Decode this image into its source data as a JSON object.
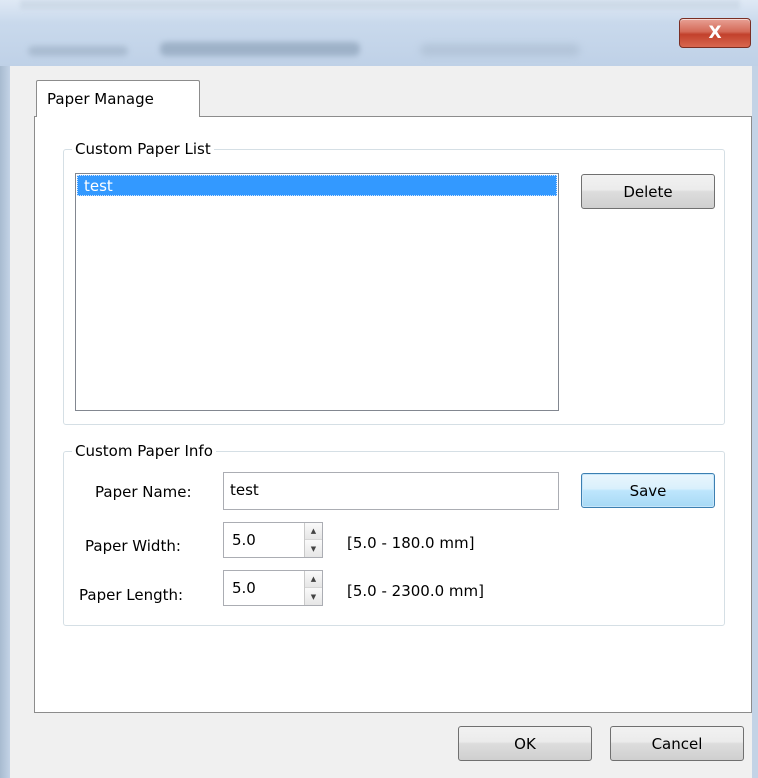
{
  "window": {
    "close_label": "X"
  },
  "tabs": [
    {
      "label": "Paper Manage"
    }
  ],
  "custom_paper_list": {
    "title": "Custom Paper List",
    "items": [
      {
        "label": "test",
        "selected": true
      }
    ],
    "delete_label": "Delete"
  },
  "custom_paper_info": {
    "title": "Custom Paper Info",
    "paper_name": {
      "label": "Paper Name:",
      "value": "test"
    },
    "paper_width": {
      "label": "Paper Width:",
      "value": "5.0",
      "range": "[5.0 - 180.0 mm]"
    },
    "paper_length": {
      "label": "Paper Length:",
      "value": "5.0",
      "range": "[5.0 - 2300.0 mm]"
    },
    "save_label": "Save"
  },
  "footer": {
    "ok_label": "OK",
    "cancel_label": "Cancel"
  },
  "colors": {
    "selection": "#3399ff",
    "close_button": "#c2412c",
    "focus_button": "#3c7fb1"
  }
}
